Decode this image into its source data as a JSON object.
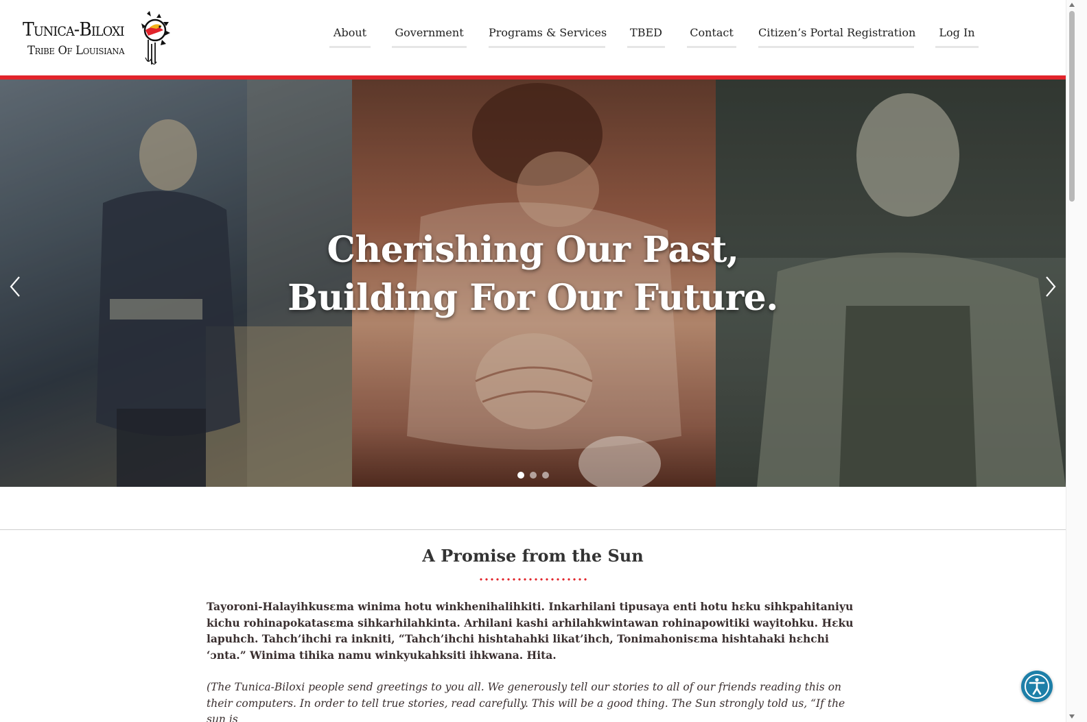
{
  "logo": {
    "line1": "Tunica-Biloxi",
    "line2": "Tribe Of Louisiana"
  },
  "nav": {
    "items": [
      {
        "label": "About"
      },
      {
        "label": "Government"
      },
      {
        "label": "Programs & Services"
      },
      {
        "label": "TBED"
      },
      {
        "label": "Contact"
      },
      {
        "label": "Citizen’s Portal Registration"
      },
      {
        "label": "Log In"
      }
    ]
  },
  "hero": {
    "title_line1": "Cherishing Our Past,",
    "title_line2": "Building For Our Future.",
    "slides": 3,
    "active_slide": 1
  },
  "section": {
    "title": "A Promise from the Sun",
    "para1": "Tayoroni-Halayihkusɛma winima hotu winkhenihalihkiti.  Inkarhilani tipusaya enti hotu hɛku sihkpahitaniyu kichu rohinapokatasɛma sihkarhilahkinta.  Arhilani kashi arhilahkwintawan rohinapowitiki wayitohku.  Hɛku lapuhch. Tahch’ihchi ra inkniti, “Tahch’ihchi hishtahahki likat’ihch, Tonimahonisɛma hishtahaki hɛhchi ‘ɔnta.” Winima tihika namu winkyukahksiti ihkwana. Hita.",
    "para2": "(The Tunica-Biloxi people send greetings to you all.  We generously tell our stories to all of our friends reading this on their computers.  In order to tell true stories, read carefully. This will be a good thing. The Sun strongly told us, “If the sun is"
  },
  "colors": {
    "accent_red": "#e1242b",
    "a11y_blue": "#1d7fa8"
  },
  "icons": {
    "prev": "chevron-left-icon",
    "next": "chevron-right-icon",
    "accessibility": "accessibility-icon"
  }
}
